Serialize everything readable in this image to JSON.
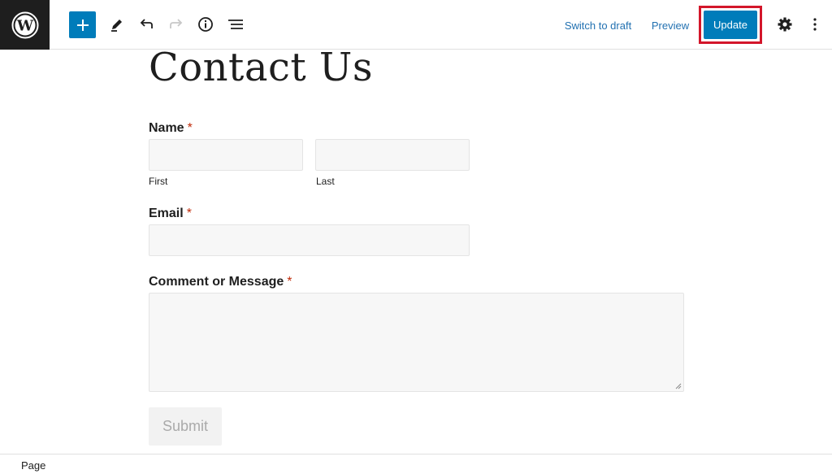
{
  "toolbar": {
    "switch_to_draft_label": "Switch to draft",
    "preview_label": "Preview",
    "update_label": "Update",
    "highlight_color": "#d3162a",
    "accent_color": "#007cba"
  },
  "page": {
    "title": "Contact Us"
  },
  "form": {
    "name_label": "Name",
    "required_mark": "*",
    "first_sublabel": "First",
    "last_sublabel": "Last",
    "email_label": "Email",
    "message_label": "Comment or Message",
    "submit_label": "Submit"
  },
  "footer": {
    "breadcrumb": "Page"
  }
}
